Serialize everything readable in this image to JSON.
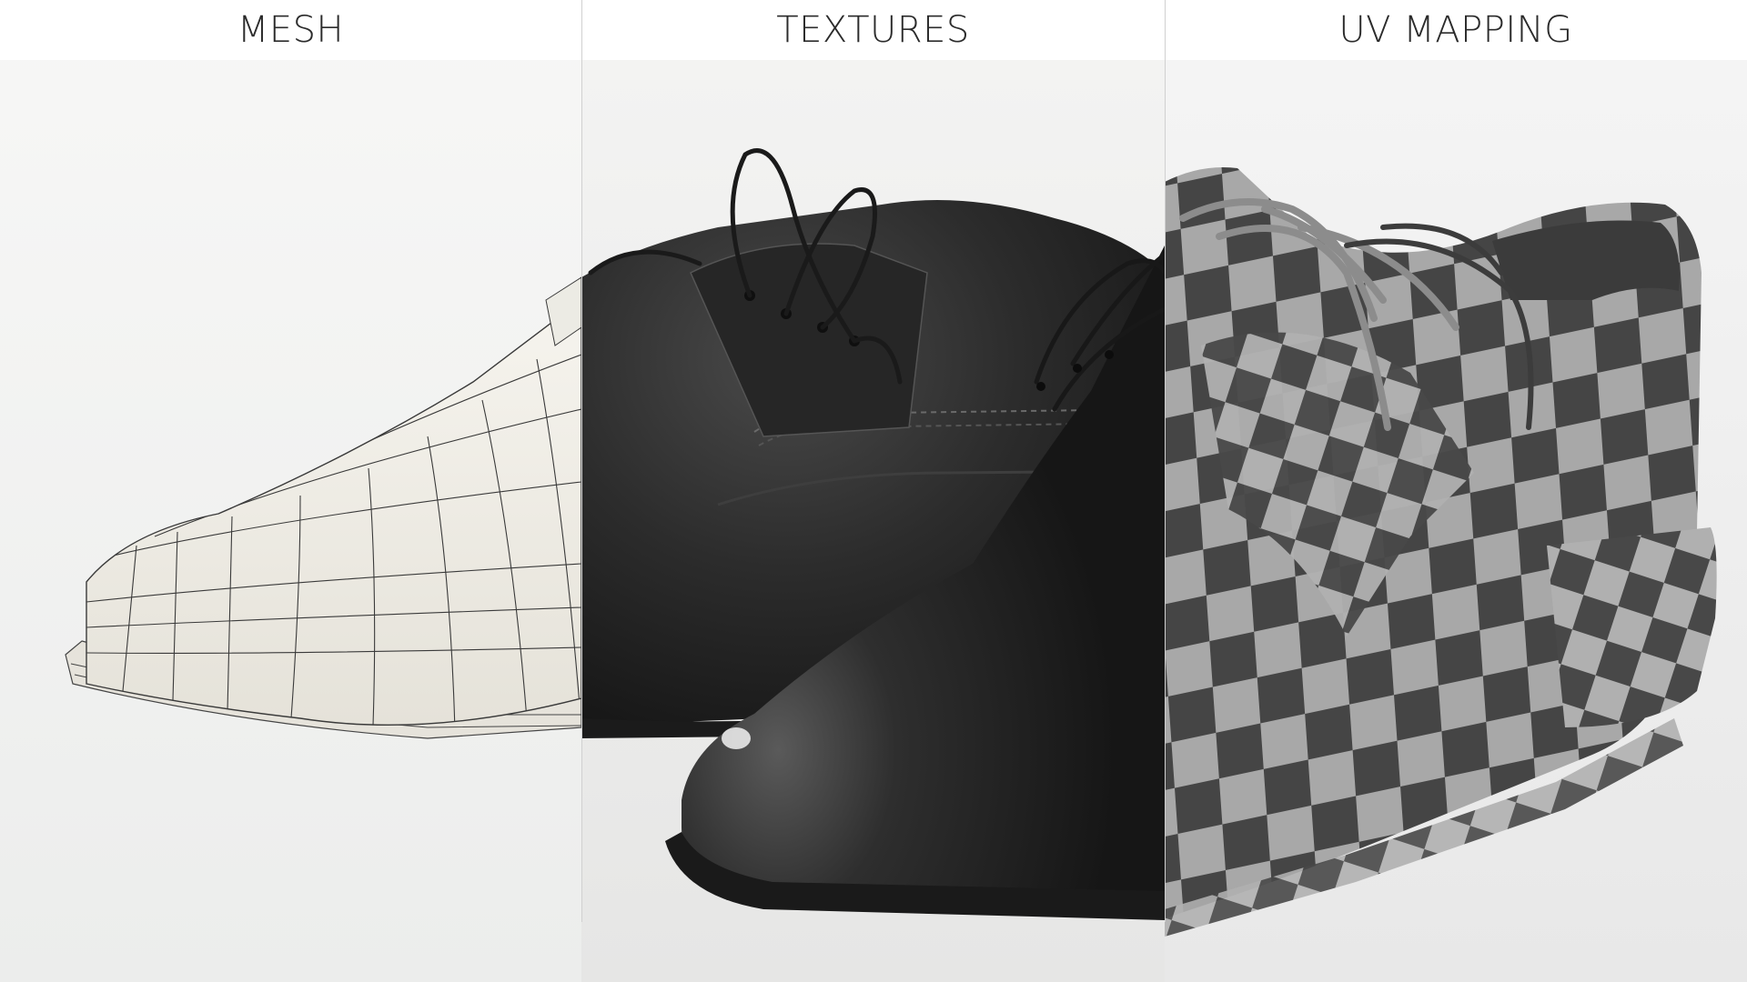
{
  "panels": [
    {
      "id": "mesh",
      "title": "MESH"
    },
    {
      "id": "textures",
      "title": "TEXTURES"
    },
    {
      "id": "uv",
      "title": "UV MAPPING"
    }
  ],
  "colors": {
    "header_bg": "#ffffff",
    "title_text": "#2b2b2b",
    "mesh_fill": "#f1efe8",
    "mesh_wire": "#3a3a3a",
    "leather": "#2a2a2a",
    "checker_dark": "#4a4a4a",
    "checker_light": "#a9a9a9"
  }
}
